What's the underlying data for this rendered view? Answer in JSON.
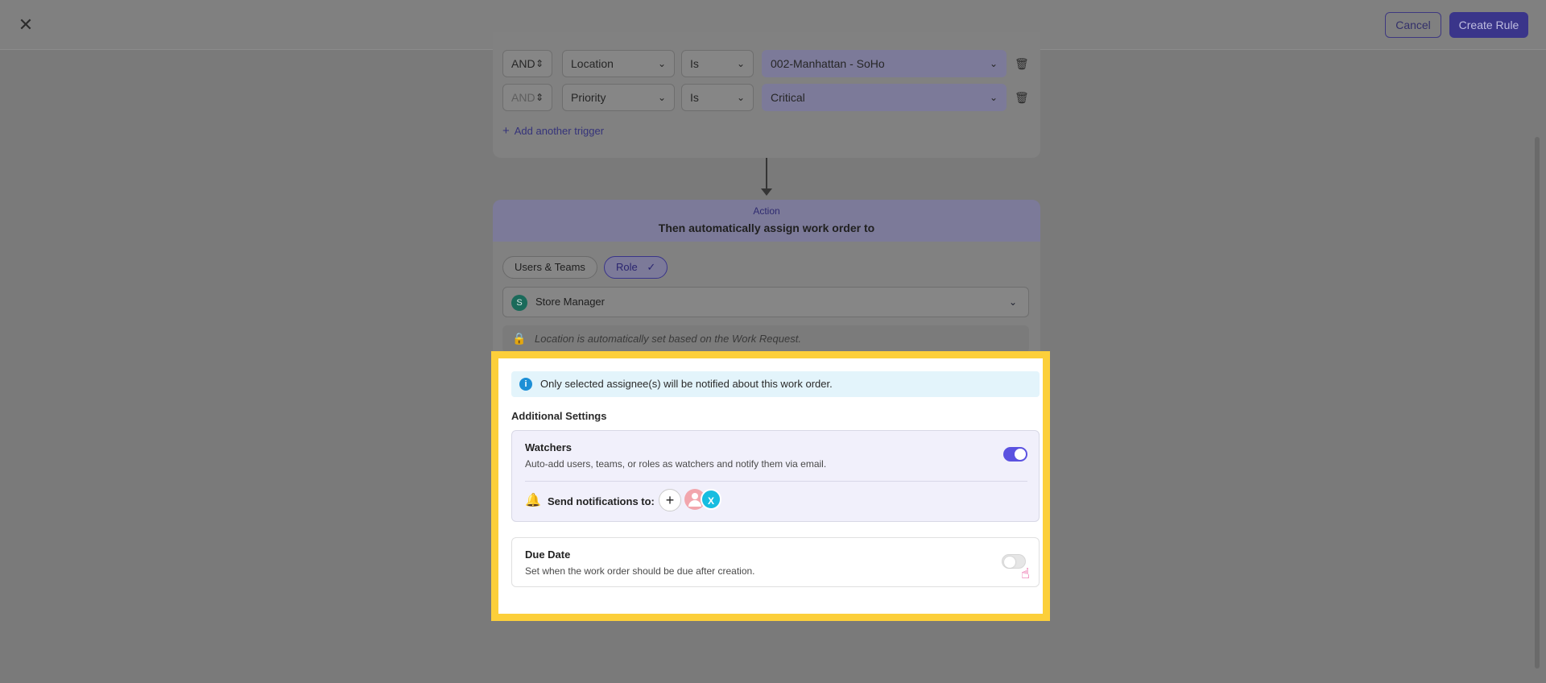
{
  "topbar": {
    "close_glyph": "✕",
    "cancel_label": "Cancel",
    "create_label": "Create Rule"
  },
  "triggers": {
    "rows": [
      {
        "operator": "AND",
        "field": "Location",
        "comparator": "Is",
        "value": "002-Manhattan - SoHo"
      },
      {
        "operator": "AND",
        "field": "Priority",
        "comparator": "Is",
        "value": "Critical"
      }
    ],
    "add_label": "Add another trigger"
  },
  "action": {
    "kicker": "Action",
    "title": "Then automatically assign work order to",
    "tabs": {
      "users_teams": "Users & Teams",
      "role": "Role"
    },
    "assignee": {
      "initial": "S",
      "name": "Store Manager"
    },
    "location_note": "Location is automatically set based on the Work Request."
  },
  "info_banner": "Only selected assignee(s) will be notified about this work order.",
  "additional_settings": {
    "heading": "Additional Settings",
    "watchers": {
      "title": "Watchers",
      "description": "Auto-add users, teams, or roles as watchers and notify them via email.",
      "enabled": true,
      "send_label": "Send notifications to:",
      "avatar_initial": "X"
    },
    "due_date": {
      "title": "Due Date",
      "description": "Set when the work order should be due after creation.",
      "enabled": false
    }
  },
  "colors": {
    "accent": "#5b52e0",
    "highlight": "#fccf3a",
    "info_bg": "#e3f4fb",
    "info_icon": "#1d8fd6"
  }
}
